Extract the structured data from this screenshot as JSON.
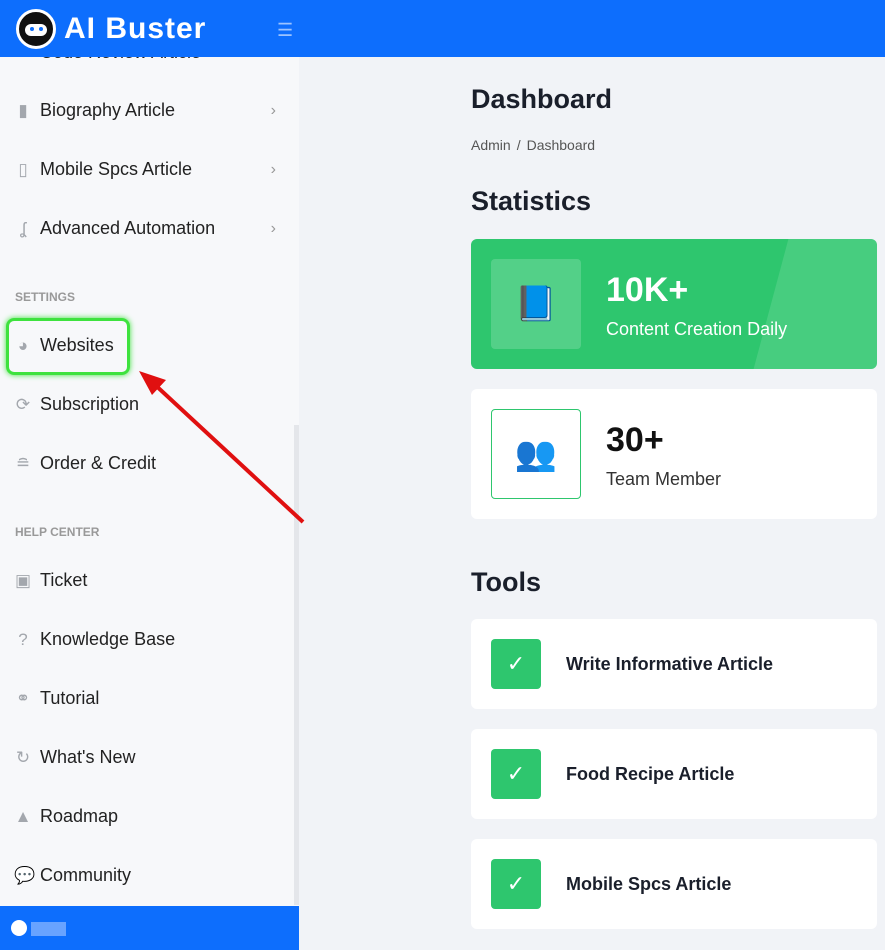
{
  "header": {
    "brand": "AI Buster",
    "menu_icon": "hamburger-icon"
  },
  "sidebar": {
    "items_top": [
      {
        "label": "Code Review Article",
        "icon": "code-icon"
      },
      {
        "label": "Biography Article",
        "icon": "book-icon"
      },
      {
        "label": "Mobile Spcs Article",
        "icon": "mobile-icon"
      },
      {
        "label": "Advanced Automation",
        "icon": "automation-icon"
      }
    ],
    "settings_title": "SETTINGS",
    "settings": [
      {
        "label": "Websites",
        "icon": "globe-icon"
      },
      {
        "label": "Subscription",
        "icon": "refresh-icon"
      },
      {
        "label": "Order & Credit",
        "icon": "coins-icon"
      }
    ],
    "help_title": "HELP CENTER",
    "help": [
      {
        "label": "Ticket",
        "icon": "clipboard-icon"
      },
      {
        "label": "Knowledge Base",
        "icon": "question-icon"
      },
      {
        "label": "Tutorial",
        "icon": "handshake-icon"
      },
      {
        "label": "What's New",
        "icon": "redo-icon"
      },
      {
        "label": "Roadmap",
        "icon": "road-icon"
      },
      {
        "label": "Community",
        "icon": "comments-icon"
      }
    ]
  },
  "main": {
    "title": "Dashboard",
    "breadcrumb": [
      "Admin",
      "/",
      "Dashboard"
    ],
    "stats_title": "Statistics",
    "stats": [
      {
        "value": "10K+",
        "label": "Content Creation Daily"
      },
      {
        "value": "30+",
        "label": "Team Member"
      }
    ],
    "tools_title": "Tools",
    "tools": [
      "Write Informative Article",
      "Food Recipe Article",
      "Mobile Spcs Article"
    ]
  },
  "colors": {
    "primary": "#0d6efd",
    "success": "#2ec66e",
    "highlight": "#3ee23e",
    "arrow": "#e01010"
  }
}
